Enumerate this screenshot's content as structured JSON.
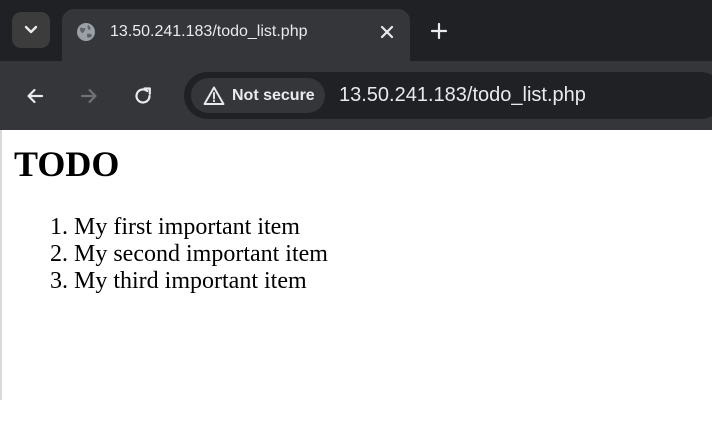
{
  "browser": {
    "tab": {
      "title": "13.50.241.183/todo_list.php"
    },
    "toolbar": {
      "security_label": "Not secure",
      "url": "13.50.241.183/todo_list.php"
    }
  },
  "page": {
    "heading": "TODO",
    "items": [
      "My first important item",
      "My second important item",
      "My third important item"
    ]
  },
  "icons": {
    "tab_search": "chevron-down-icon",
    "favicon": "globe-icon",
    "close": "close-icon",
    "new_tab": "plus-icon",
    "back": "arrow-left-icon",
    "forward": "arrow-right-icon",
    "reload": "reload-icon",
    "security": "warning-icon"
  },
  "colors": {
    "tabstrip_bg": "#202124",
    "toolbar_bg": "#35363a",
    "omnibox_bg": "#202124",
    "text_light": "#e8eaed",
    "disabled_icon": "#6f7175",
    "page_bg": "#ffffff",
    "page_text": "#000000"
  }
}
